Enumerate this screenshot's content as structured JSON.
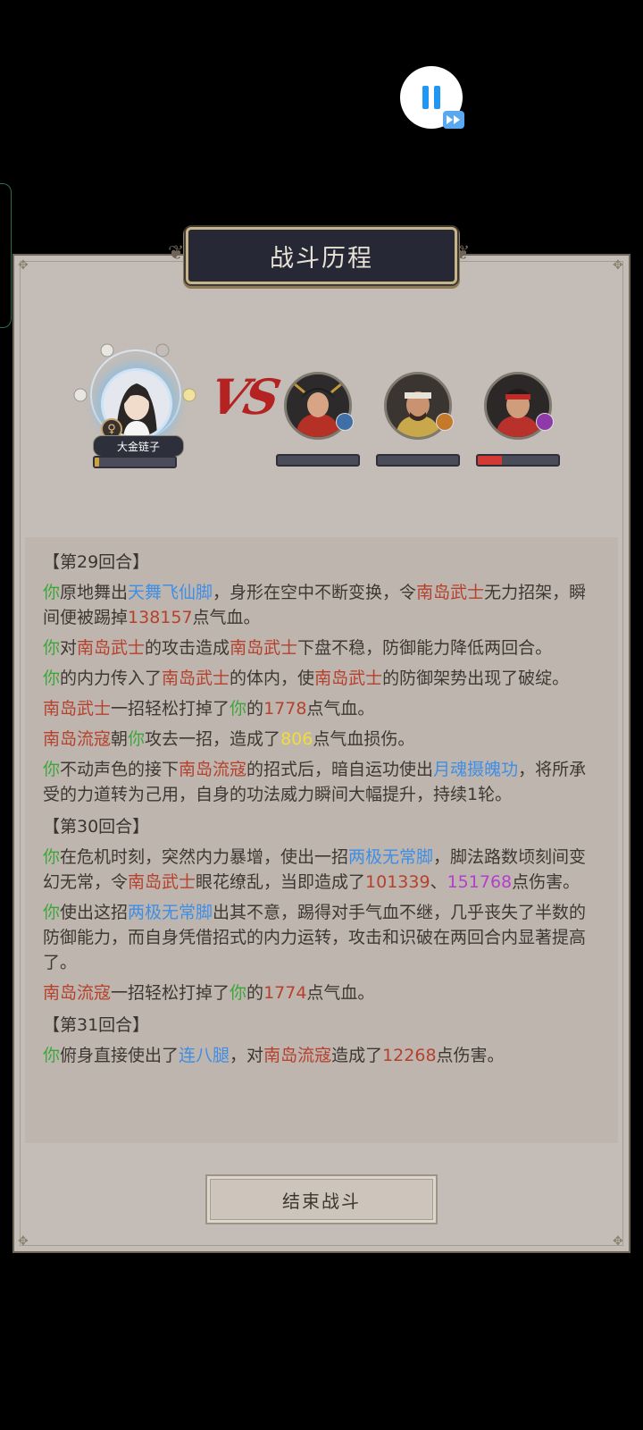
{
  "hud": {
    "pause_icon": "pause-icon",
    "speed_icon": "fast-forward-icon"
  },
  "panel": {
    "title": "战斗历程"
  },
  "player": {
    "name": "大金链子",
    "gender_icon": "female-icon",
    "hp_fraction": 0.05
  },
  "vs_label": "VS",
  "enemies": [
    {
      "hp_fraction": 0.0,
      "badge_color": "#3f6fa6"
    },
    {
      "hp_fraction": 0.0,
      "badge_color": "#c47a2a"
    },
    {
      "hp_fraction": 0.3,
      "badge_color": "#8e3aa8"
    }
  ],
  "log": {
    "r29": {
      "header": "【第29回合】",
      "e1": {
        "a": "你",
        "b": "原地舞出",
        "c": "天舞飞仙脚",
        "d": "，身形在空中不断变换，令",
        "e": "南岛武士",
        "f": "无力招架，瞬间便被踢掉",
        "g": "138157",
        "h": "点气血。"
      },
      "e2": {
        "a": "你",
        "b": "对",
        "c": "南岛武士",
        "d": "的攻击造成",
        "e": "南岛武士",
        "f": "下盘不稳，防御能力降低两回合。"
      },
      "e3": {
        "a": "你",
        "b": "的内力传入了",
        "c": "南岛武士",
        "d": "的体内，使",
        "e": "南岛武士",
        "f": "的防御架势出现了破绽。"
      },
      "e4": {
        "a": "南岛武士",
        "b": "一招轻松打掉了",
        "c": "你",
        "d": "的",
        "e": "1778",
        "f": "点气血。"
      },
      "e5": {
        "a": "南岛流寇",
        "b": "朝",
        "c": "你",
        "d": "攻去一招，造成了",
        "e": "806",
        "f": "点气血损伤。"
      },
      "e6": {
        "a": "你",
        "b": "不动声色的接下",
        "c": "南岛流寇",
        "d": "的招式后，暗自运功使出",
        "e": "月魂摄魄功",
        "f": "，将所承受的力道转为己用，自身的功法威力瞬间大幅提升，持续1轮。"
      }
    },
    "r30": {
      "header": "【第30回合】",
      "e1": {
        "a": "你",
        "b": "在危机时刻，突然内力暴增，使出一招",
        "c": "两极无常脚",
        "d": "，脚法路数顷刻间变幻无常，令",
        "e": "南岛武士",
        "f": "眼花缭乱，当即造成了",
        "g": "101339",
        "h": "、",
        "i": "151768",
        "j": "点伤害。"
      },
      "e2": {
        "a": "你",
        "b": "使出这招",
        "c": "两极无常脚",
        "d": "出其不意，踢得对手气血不继，几乎丧失了半数的防御能力，而自身凭借招式的内力运转，攻击和识破在两回合内显著提高了。"
      },
      "e3": {
        "a": "南岛流寇",
        "b": "一招轻松打掉了",
        "c": "你",
        "d": "的",
        "e": "1774",
        "f": "点气血。"
      }
    },
    "r31": {
      "header": "【第31回合】",
      "e1": {
        "a": "你",
        "b": "俯身直接使出了",
        "c": "连八腿",
        "d": "，对",
        "e": "南岛流寇",
        "f": "造成了",
        "g": "12268",
        "h": "点伤害。"
      }
    }
  },
  "end_button": "结束战斗"
}
